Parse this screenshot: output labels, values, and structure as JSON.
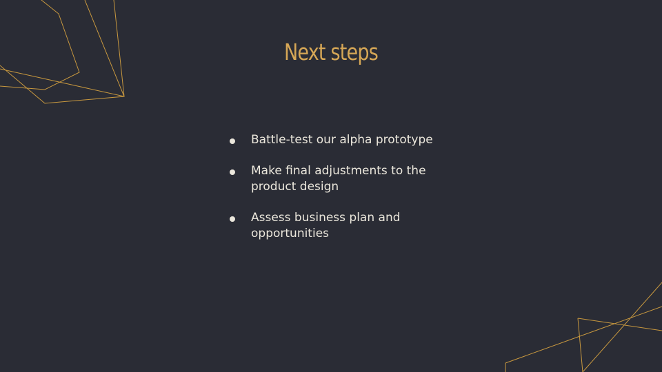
{
  "slide": {
    "title": "Next steps",
    "bullets": [
      {
        "text": "Battle-test our alpha prototype"
      },
      {
        "text": "Make final adjustments to the product design"
      },
      {
        "text": "Assess business plan and opportunities"
      }
    ]
  },
  "colors": {
    "background": "#2a2c35",
    "accent": "#d6a756",
    "text": "#ebe7dc",
    "line": "#c9993f"
  }
}
